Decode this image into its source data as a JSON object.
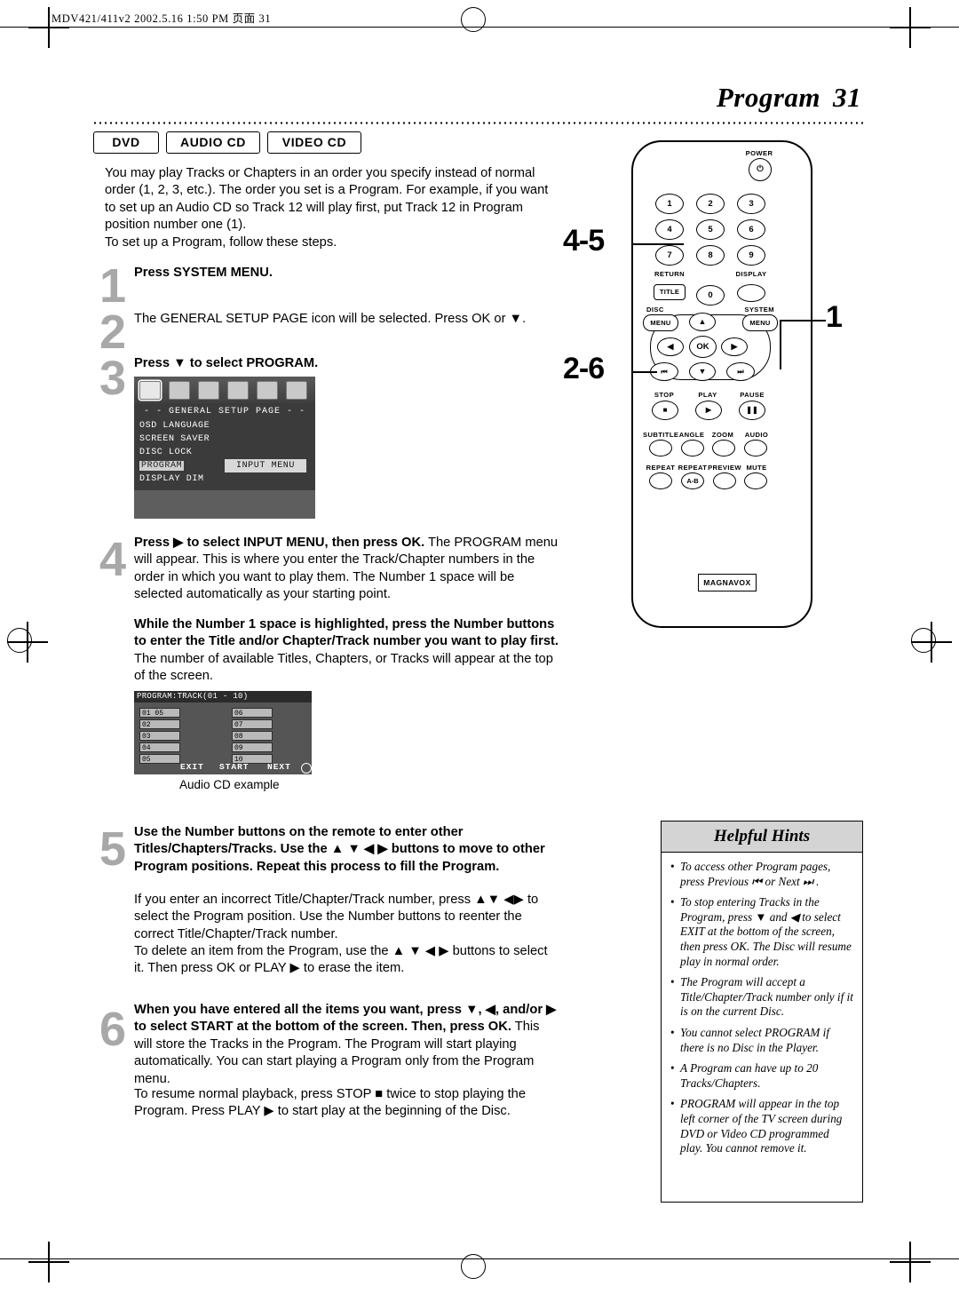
{
  "header": {
    "running_head": "MDV421/411v2  2002.5.16  1:50 PM  页面 31"
  },
  "page": {
    "title": "Program",
    "number": "31"
  },
  "media_types": [
    {
      "label": "DVD"
    },
    {
      "label": "AUDIO CD"
    },
    {
      "label": "VIDEO CD"
    }
  ],
  "intro": {
    "p1": "You may play Tracks or Chapters in an order you specify instead of normal order (1, 2, 3, etc.). The order you set is a Program. For example, if you want to set up an Audio CD so Track 12 will play first, put Track 12 in Program position number one (1).",
    "p2": "To set up a Program, follow these steps."
  },
  "steps": [
    {
      "num": "1",
      "text": "Press SYSTEM MENU."
    },
    {
      "num": "2",
      "text": "The GENERAL SETUP PAGE icon will be selected. Press OK or ▼."
    },
    {
      "num": "3",
      "text": "Press ▼ to select PROGRAM."
    },
    {
      "num": "4",
      "text_bold": "Press ▶ to select INPUT MENU, then press OK.",
      "text": "The PROGRAM menu will appear. This is where you enter the Track/Chapter numbers in the order in which you want to play them. The Number 1 space will be selected automatically as your starting point.",
      "text2_bold": "While the Number 1 space is highlighted, press the Number buttons to enter the Title and/or Chapter/Track number you want to play first.",
      "text2": "The number of available Titles, Chapters, or Tracks will appear at the top of the screen."
    },
    {
      "num": "5",
      "text_bold": "Use the Number buttons on the remote to enter other Titles/Chapters/Tracks. Use the ▲ ▼ ◀ ▶ buttons to move to other Program positions. Repeat this process to fill the Program.",
      "text": "If you enter an incorrect Title/Chapter/Track number, press ▲▼ ◀▶ to select the Program position. Use the Number buttons to reenter the correct Title/Chapter/Track number.",
      "text2": "To delete an item from the Program, use the ▲ ▼ ◀ ▶ buttons to select it. Then press OK or PLAY ▶ to erase the item."
    },
    {
      "num": "6",
      "text_bold": "When you have entered all the items you want, press ▼, ◀, and/or ▶ to select START at the bottom of the screen. Then, press OK.",
      "text": "This will store the Tracks in the Program. The Program will start playing automatically. You can start playing a Program only from the Program menu.",
      "text2": "To resume normal playback, press STOP ■ twice to stop playing the Program. Press PLAY ▶ to start play at the beginning of the Disc."
    }
  ],
  "osd_setup": {
    "title": "- -  GENERAL  SETUP  PAGE  - -",
    "rows": [
      {
        "label": "OSD LANGUAGE",
        "value": ""
      },
      {
        "label": "SCREEN SAVER",
        "value": ""
      },
      {
        "label": "DISC LOCK",
        "value": ""
      },
      {
        "label": "PROGRAM",
        "value": "INPUT MENU",
        "highlighted": true
      },
      {
        "label": "DISPLAY DIM",
        "value": ""
      }
    ]
  },
  "osd_program": {
    "title": "PROGRAM:TRACK(01 - 10)",
    "left_cells": [
      {
        "index": "01",
        "value": "05"
      },
      {
        "index": "02",
        "value": ""
      },
      {
        "index": "03",
        "value": ""
      },
      {
        "index": "04",
        "value": ""
      },
      {
        "index": "05",
        "value": ""
      }
    ],
    "right_cells": [
      {
        "index": "06",
        "value": ""
      },
      {
        "index": "07",
        "value": ""
      },
      {
        "index": "08",
        "value": ""
      },
      {
        "index": "09",
        "value": ""
      },
      {
        "index": "10",
        "value": ""
      }
    ],
    "footer": {
      "exit": "EXIT",
      "start": "START",
      "next": "NEXT"
    },
    "caption": "Audio CD example"
  },
  "remote": {
    "brand": "MAGNAVOX",
    "power_label": "POWER",
    "number_keys": [
      "1",
      "2",
      "3",
      "4",
      "5",
      "6",
      "7",
      "8",
      "9",
      "0"
    ],
    "labels": {
      "return": "RETURN",
      "display": "DISPLAY",
      "title": "TITLE",
      "disc": "DISC",
      "system": "SYSTEM",
      "menu_left": "MENU",
      "menu_right": "MENU",
      "ok": "OK",
      "stop": "STOP",
      "play": "PLAY",
      "pause": "PAUSE",
      "subtitle": "SUBTITLE",
      "angle": "ANGLE",
      "zoom": "ZOOM",
      "audio": "AUDIO",
      "repeat": "REPEAT",
      "repeat_ab": "REPEAT",
      "ab": "A-B",
      "preview": "PREVIEW",
      "mute": "MUTE"
    },
    "callouts": [
      {
        "text": "4-5"
      },
      {
        "text": "2-6"
      },
      {
        "text": "1"
      }
    ]
  },
  "hints": {
    "title": "Helpful Hints",
    "items": [
      "To access other Program pages, press Previous ⏮ or Next ⏭ .",
      " To stop entering Tracks in the Program, press ▼ and ◀ to select EXIT at the bottom of the screen, then press OK. The Disc will resume play in normal order.",
      "The Program will accept a Title/Chapter/Track number only if it is on the current Disc.",
      "You cannot select PROGRAM if there is no Disc in the Player.",
      "A Program can have up to 20 Tracks/Chapters.",
      "PROGRAM will appear in the top left corner of the TV screen during DVD or Video CD programmed play. You cannot remove it."
    ]
  }
}
